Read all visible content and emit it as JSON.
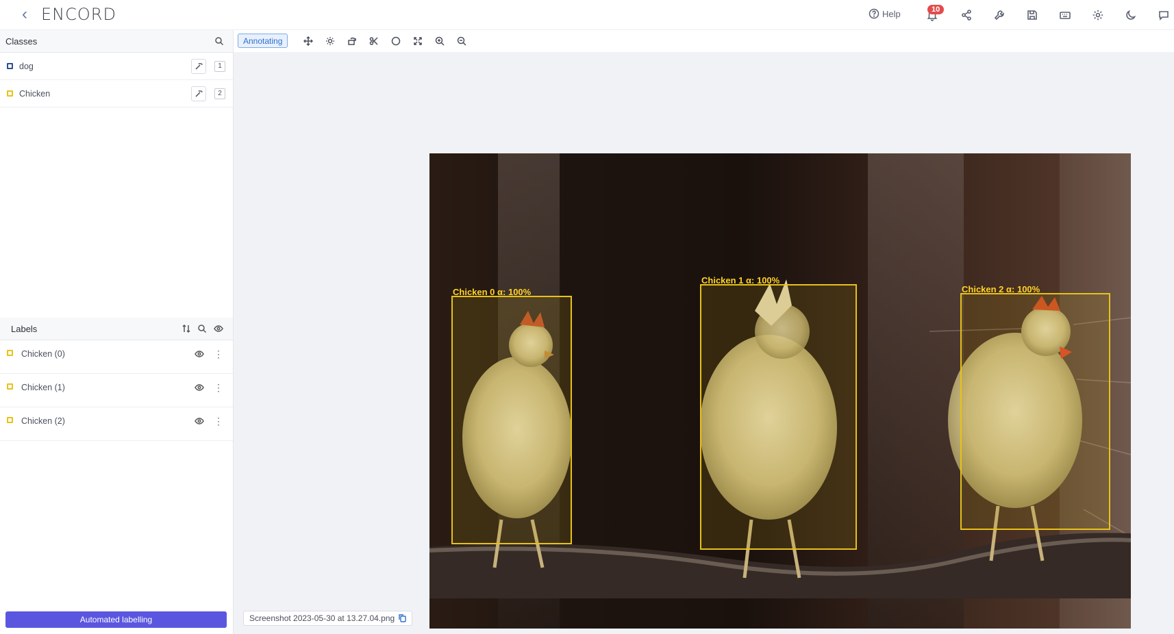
{
  "header": {
    "logo": "ENCORD",
    "help_label": "Help",
    "notification_count": "10",
    "icons": [
      "share-icon",
      "wrench-icon",
      "save-icon",
      "keyboard-icon",
      "gear-icon",
      "moon-icon",
      "chat-icon"
    ]
  },
  "classes_panel": {
    "title": "Classes",
    "items": [
      {
        "label": "dog",
        "hotkey": "1",
        "color": "#2f4f8f"
      },
      {
        "label": "Chicken",
        "hotkey": "2",
        "color": "#e8c21a"
      }
    ]
  },
  "labels_panel": {
    "title": "Labels",
    "items": [
      {
        "label": "Chicken (0)",
        "color": "#e8c21a"
      },
      {
        "label": "Chicken (1)",
        "color": "#e8c21a"
      },
      {
        "label": "Chicken (2)",
        "color": "#e8c21a"
      }
    ]
  },
  "automated_button": "Automated labelling",
  "toolbar": {
    "mode_label": "Annotating",
    "tools": [
      "move-icon",
      "brightness-icon",
      "rotate-icon",
      "scissors-icon",
      "comment-icon",
      "fullscreen-icon",
      "zoom-in-icon",
      "zoom-out-icon"
    ]
  },
  "canvas": {
    "annotations": [
      {
        "label": "Chicken 0 α: 100%"
      },
      {
        "label": "Chicken 1 α: 100%"
      },
      {
        "label": "Chicken 2 α: 100%"
      }
    ]
  },
  "filename": "Screenshot 2023-05-30 at 13.27.04.png"
}
